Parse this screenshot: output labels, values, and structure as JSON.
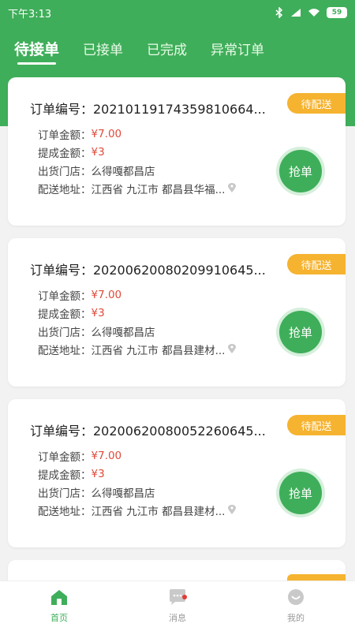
{
  "status_bar": {
    "time": "下午3:13",
    "battery": "59"
  },
  "tabs": [
    {
      "label": "待接单",
      "active": true
    },
    {
      "label": "已接单",
      "active": false
    },
    {
      "label": "已完成",
      "active": false
    },
    {
      "label": "异常订单",
      "active": false
    }
  ],
  "orders": [
    {
      "status": "待配送",
      "order_no": "订单编号：20210119174359810664...",
      "amount_label": "订单金额：",
      "amount": "¥7.00",
      "commission_label": "提成金额：",
      "commission": "¥3",
      "store_label": "出货门店：",
      "store": "么得嘎都昌店",
      "address_label": "配送地址：",
      "address": "江西省 九江市 都昌县华福...",
      "action": "抢单"
    },
    {
      "status": "待配送",
      "order_no": "订单编号：20200620080209910645...",
      "amount_label": "订单金额：",
      "amount": "¥7.00",
      "commission_label": "提成金额：",
      "commission": "¥3",
      "store_label": "出货门店：",
      "store": "么得嘎都昌店",
      "address_label": "配送地址：",
      "address": "江西省 九江市 都昌县建材...",
      "action": "抢单"
    },
    {
      "status": "待配送",
      "order_no": "订单编号：20200620080052260645...",
      "amount_label": "订单金额：",
      "amount": "¥7.00",
      "commission_label": "提成金额：",
      "commission": "¥3",
      "store_label": "出货门店：",
      "store": "么得嘎都昌店",
      "address_label": "配送地址：",
      "address": "江西省 九江市 都昌县建材...",
      "action": "抢单"
    }
  ],
  "bottom_nav": [
    {
      "label": "首页",
      "icon": "home-icon",
      "active": true
    },
    {
      "label": "消息",
      "icon": "message-icon",
      "active": false,
      "has_dot": true
    },
    {
      "label": "我的",
      "icon": "profile-icon",
      "active": false
    }
  ],
  "colors": {
    "primary": "#3fae5a",
    "badge": "#f5b330",
    "price": "#e04a3a"
  }
}
